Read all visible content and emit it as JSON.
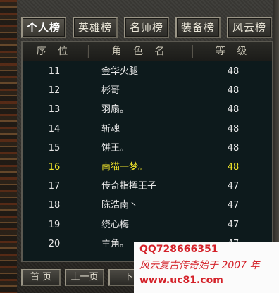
{
  "tabs": [
    "个人榜",
    "英雄榜",
    "名师榜",
    "装备榜",
    "风云榜"
  ],
  "active_tab": "个人榜",
  "columns": {
    "rank": "序 位",
    "name": "角 色 名",
    "level": "等 级"
  },
  "rows": [
    {
      "rank": "11",
      "name": "金华火腿",
      "level": "48",
      "highlight": false
    },
    {
      "rank": "12",
      "name": "彬哥",
      "level": "48",
      "highlight": false
    },
    {
      "rank": "13",
      "name": "羽扇。",
      "level": "48",
      "highlight": false
    },
    {
      "rank": "14",
      "name": "斩魂",
      "level": "48",
      "highlight": false
    },
    {
      "rank": "15",
      "name": "饼王。",
      "level": "48",
      "highlight": false
    },
    {
      "rank": "16",
      "name": "南猫一梦。",
      "level": "48",
      "highlight": true
    },
    {
      "rank": "17",
      "name": "传奇指挥王子",
      "level": "47",
      "highlight": false
    },
    {
      "rank": "18",
      "name": "陈浩南丶",
      "level": "47",
      "highlight": false
    },
    {
      "rank": "19",
      "name": "绕心梅",
      "level": "47",
      "highlight": false
    },
    {
      "rank": "20",
      "name": "主角。",
      "level": "47",
      "highlight": false
    }
  ],
  "nav": {
    "first": "首 页",
    "prev": "上一页",
    "next": "下"
  },
  "watermark": {
    "qq": "QQ728666351",
    "slogan": "风云复古传奇始于 2007 年",
    "url": "www.uc81.com"
  },
  "colors": {
    "highlight": "#f2e62a",
    "text": "#e6e6e6",
    "watermark": "#d4222a"
  }
}
